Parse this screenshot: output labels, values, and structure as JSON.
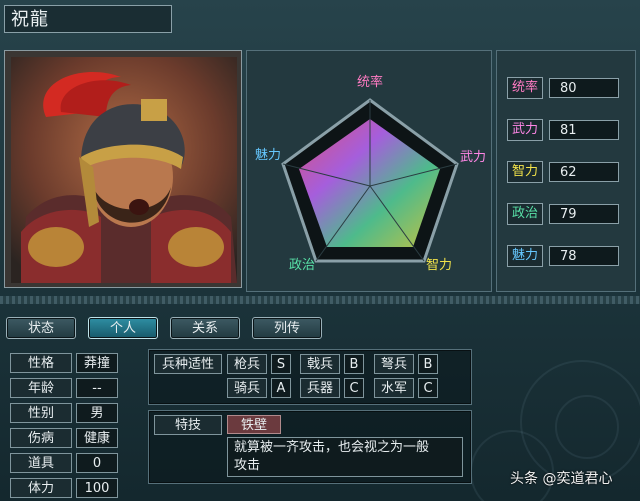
{
  "character": {
    "name": "祝龍"
  },
  "radar": {
    "labels": {
      "top": "统率",
      "right": "武力",
      "bottom_right": "智力",
      "bottom_left": "政治",
      "left": "魅力"
    }
  },
  "stats": [
    {
      "label": "统率",
      "value": "80",
      "color": "#ff7bc3"
    },
    {
      "label": "武力",
      "value": "81",
      "color": "#ff86e6"
    },
    {
      "label": "智力",
      "value": "62",
      "color": "#f1e24a"
    },
    {
      "label": "政治",
      "value": "79",
      "color": "#58e0a7"
    },
    {
      "label": "魅力",
      "value": "78",
      "color": "#66c8ff"
    }
  ],
  "tabs": [
    "状态",
    "个人",
    "关系",
    "列传"
  ],
  "active_tab": "个人",
  "profile": [
    {
      "label": "性格",
      "value": "莽撞"
    },
    {
      "label": "年龄",
      "value": "--"
    },
    {
      "label": "性别",
      "value": "男"
    },
    {
      "label": "伤病",
      "value": "健康"
    },
    {
      "label": "道具",
      "value": "0"
    },
    {
      "label": "体力",
      "value": "100"
    }
  ],
  "aptitude": {
    "title": "兵种适性",
    "row1": [
      {
        "unit": "枪兵",
        "grade": "S"
      },
      {
        "unit": "戟兵",
        "grade": "B"
      },
      {
        "unit": "弩兵",
        "grade": "B"
      }
    ],
    "row2": [
      {
        "unit": "骑兵",
        "grade": "A"
      },
      {
        "unit": "兵器",
        "grade": "C"
      },
      {
        "unit": "水军",
        "grade": "C"
      }
    ]
  },
  "skill": {
    "title": "特技",
    "name": "铁壁",
    "description_line1": "就算被一齐攻击，也会视之为一般",
    "description_line2": "攻击"
  },
  "watermark": "头条 @奕道君心"
}
